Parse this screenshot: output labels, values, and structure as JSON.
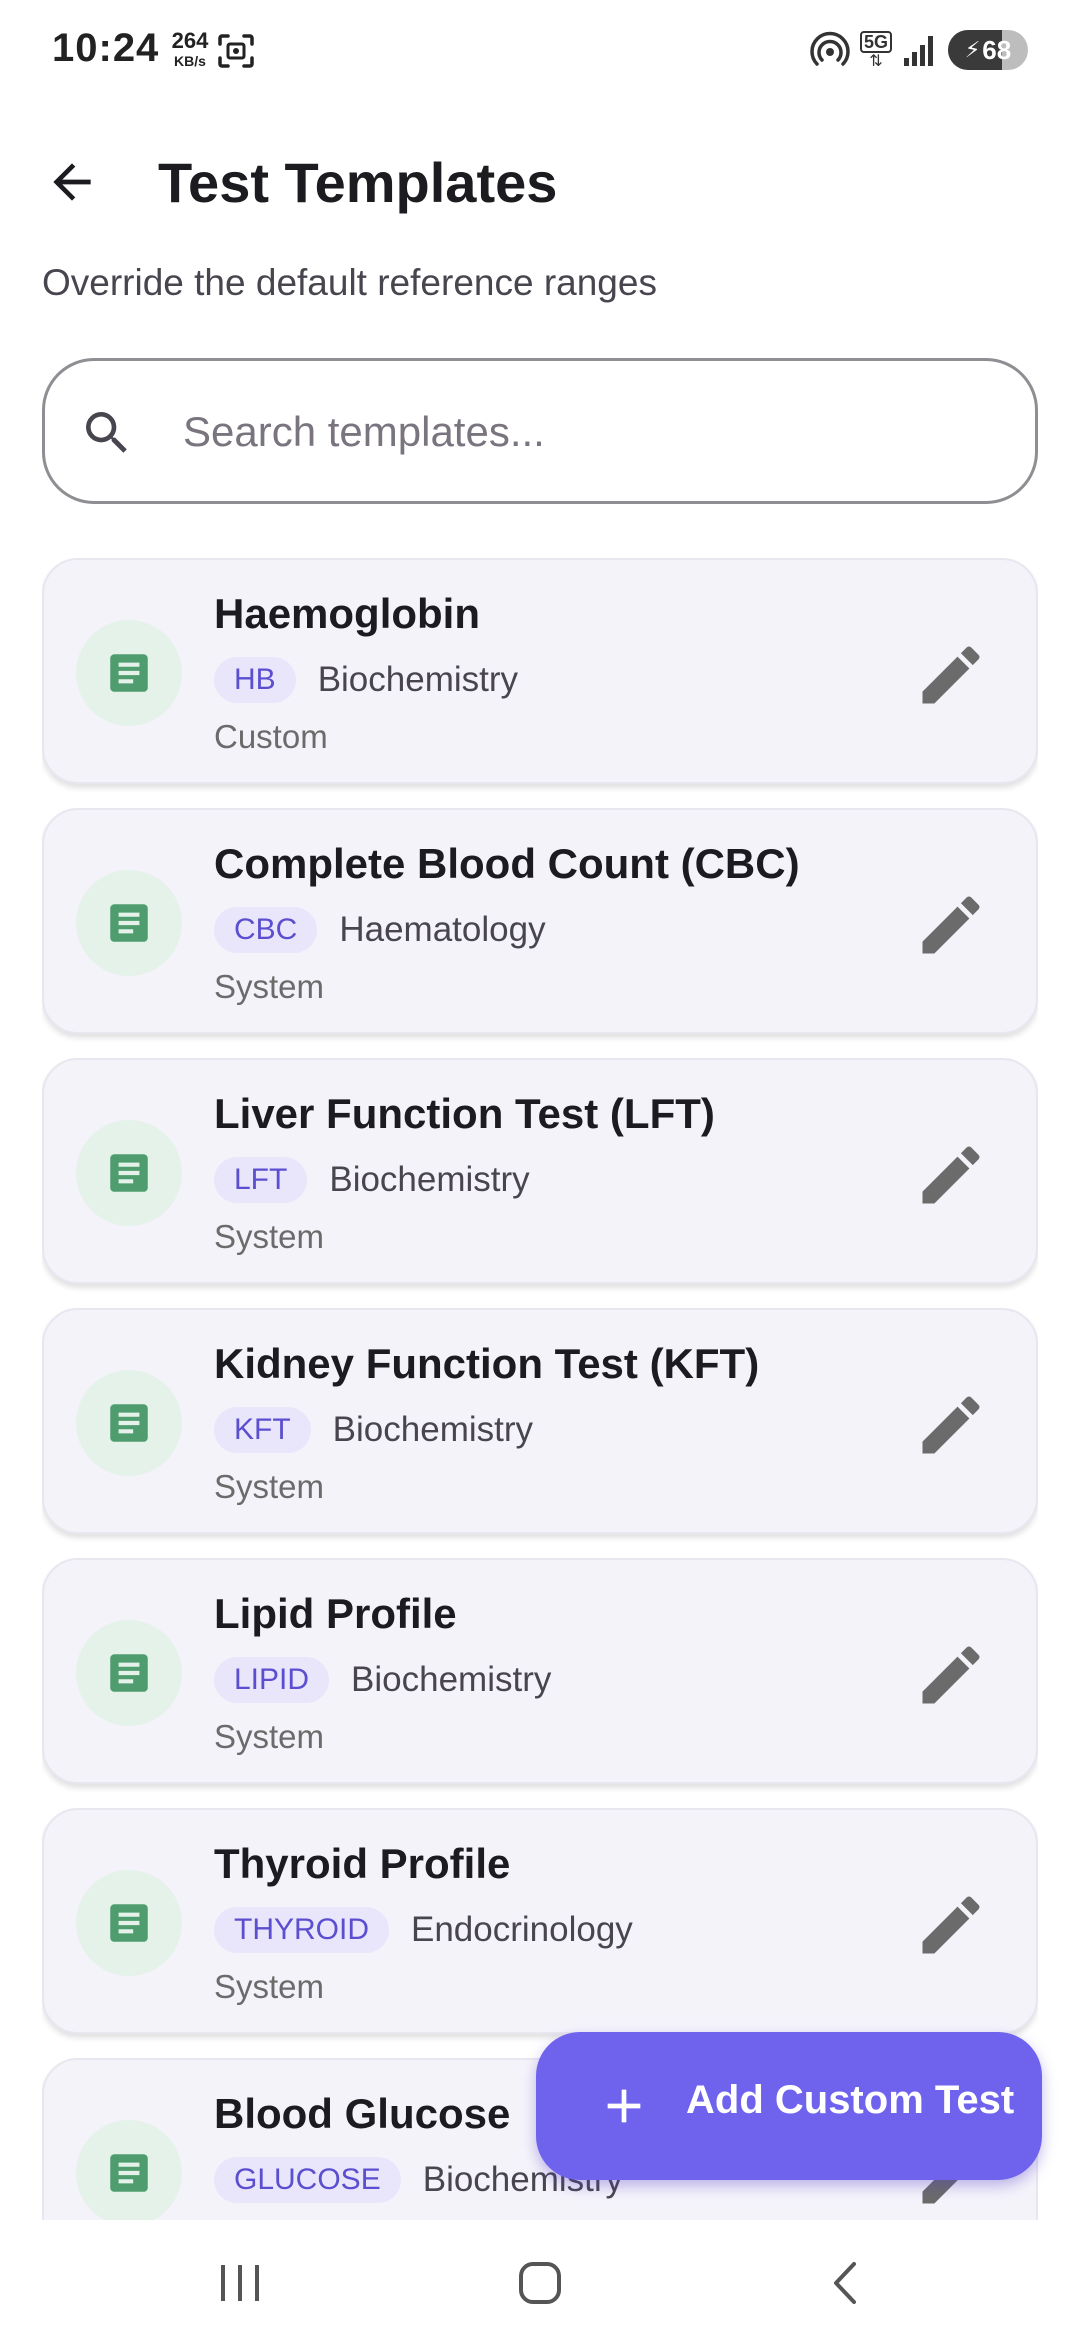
{
  "status_bar": {
    "time": "10:24",
    "net_speed_value": "264",
    "net_speed_unit": "KB/s",
    "network_type": "5G",
    "battery_level": "68"
  },
  "header": {
    "title": "Test Templates",
    "subtitle": "Override the default reference ranges"
  },
  "search": {
    "placeholder": "Search templates...",
    "value": ""
  },
  "templates": [
    {
      "name": "Haemoglobin",
      "code": "HB",
      "category": "Biochemistry",
      "source": "Custom"
    },
    {
      "name": "Complete Blood Count (CBC)",
      "code": "CBC",
      "category": "Haematology",
      "source": "System"
    },
    {
      "name": "Liver Function Test (LFT)",
      "code": "LFT",
      "category": "Biochemistry",
      "source": "System"
    },
    {
      "name": "Kidney Function Test (KFT)",
      "code": "KFT",
      "category": "Biochemistry",
      "source": "System"
    },
    {
      "name": "Lipid Profile",
      "code": "LIPID",
      "category": "Biochemistry",
      "source": "System"
    },
    {
      "name": "Thyroid Profile",
      "code": "THYROID",
      "category": "Endocrinology",
      "source": "System"
    },
    {
      "name": "Blood Glucose",
      "code": "GLUCOSE",
      "category": "Biochemistry",
      "source": ""
    }
  ],
  "fab": {
    "label": "Add Custom Test"
  },
  "colors": {
    "accent": "#6f63ee",
    "chip_bg": "#e9e5fb",
    "chip_text": "#5b4fcf",
    "doc_icon": "#4f9d6e",
    "card_bg": "#f5f3fa"
  },
  "icons": {
    "back": "arrow-back-icon",
    "search": "search-icon",
    "template": "document-icon",
    "edit": "pencil-icon",
    "fab": "plus-icon"
  }
}
